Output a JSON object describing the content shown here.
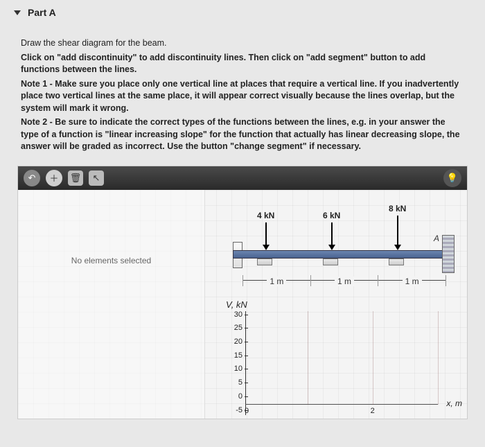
{
  "header": {
    "part_label": "Part A"
  },
  "instructions": {
    "line1": "Draw the shear diagram for the beam.",
    "line2a": "Click on \"add discontinuity\" to add discontinuity lines. Then click on \"add segment\" button to add functions between the lines.",
    "note1": "Note 1 - Make sure you place only one vertical line at places that require a vertical line. If you inadvertently place two vertical lines at the same place, it will appear correct visually because the lines overlap, but the system will mark it wrong.",
    "note2": "Note 2 - Be sure to indicate the correct types of the functions between the lines, e.g. in your answer the type of a function is \"linear increasing slope\" for the function that actually has linear decreasing slope, the answer will be graded as incorrect. Use the button \"change segment\" if necessary."
  },
  "toolbar": {
    "undo_glyph": "↶",
    "add_glyph": "＋",
    "trash_glyph": "🗑",
    "cursor_glyph": "↖",
    "hint_glyph": "💡"
  },
  "side_panel": {
    "empty_msg": "No elements selected"
  },
  "figure": {
    "force1": "4 kN",
    "force2": "6 kN",
    "force3": "8 kN",
    "pointA": "A",
    "dim1": "1 m",
    "dim2": "1 m",
    "dim3": "1 m"
  },
  "chart_data": {
    "type": "line",
    "title": "",
    "ylabel": "V, kN",
    "xlabel": "x, m",
    "ylim": [
      -5,
      30
    ],
    "xlim": [
      0,
      3
    ],
    "yticks": [
      30,
      25,
      20,
      15,
      10,
      5,
      0,
      -5
    ],
    "xticks": [
      0,
      2
    ],
    "series": []
  }
}
